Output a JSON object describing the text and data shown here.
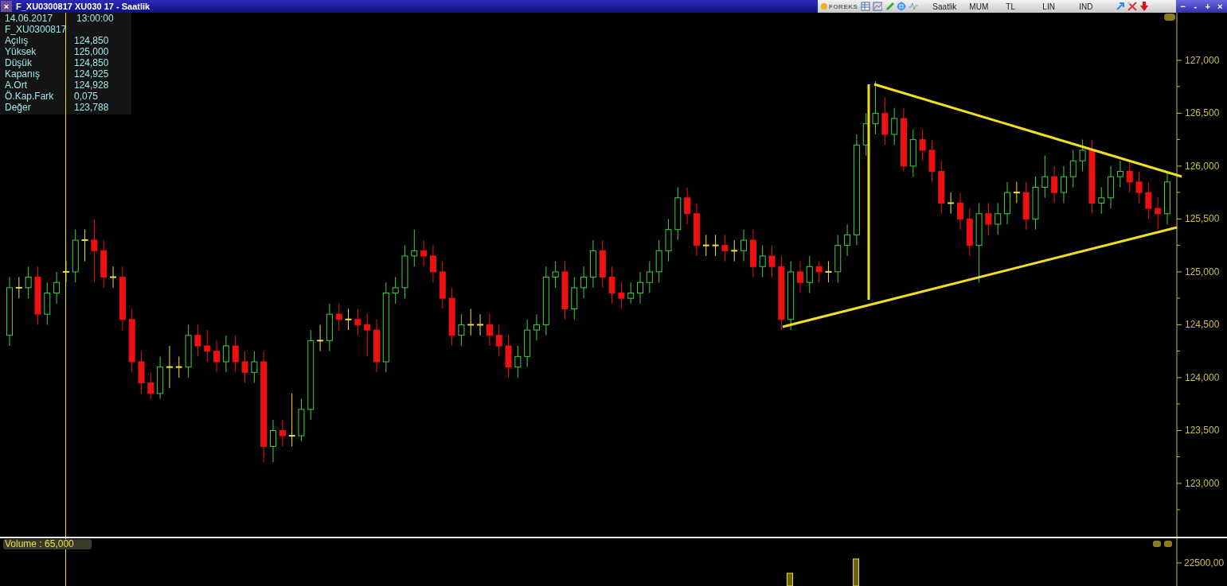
{
  "window": {
    "close": "×",
    "title": "F_XU0300817 XU030 17  - Saatlik"
  },
  "toolbar": {
    "logo": "FOREKS",
    "items": [
      "Saatlik",
      "MUM",
      "TL",
      "LIN",
      "IND"
    ],
    "window_buttons": [
      "−",
      "-",
      "+",
      "×"
    ]
  },
  "info_panel": {
    "date": "14.06.2017",
    "time": "13:00:00",
    "symbol": "F_XU0300817",
    "rows": [
      {
        "label": "Açılış",
        "value": "124,850"
      },
      {
        "label": "Yüksek",
        "value": "125,000"
      },
      {
        "label": "Düşük",
        "value": "124,850"
      },
      {
        "label": "Kapanış",
        "value": "124,925"
      },
      {
        "label": "A.Ort",
        "value": "124,928"
      },
      {
        "label": "Ö.Kap.Fark",
        "value": "0,075"
      },
      {
        "label": "Değer",
        "value": "123,788"
      }
    ]
  },
  "price_chart": {
    "chart_data": {
      "type": "candlestick",
      "ylim": [
        122,
        127.45
      ],
      "yticks": [
        {
          "value": 127,
          "label": "127,000"
        },
        {
          "value": 126.5,
          "label": "126,500"
        },
        {
          "value": 126,
          "label": "126,000"
        },
        {
          "value": 125.5,
          "label": "125,500"
        },
        {
          "value": 125,
          "label": "125,000"
        },
        {
          "value": 124.5,
          "label": "124,500"
        },
        {
          "value": 124,
          "label": "124,000"
        },
        {
          "value": 123.5,
          "label": "123,500"
        },
        {
          "value": 123,
          "label": "123,000"
        }
      ],
      "categories": [
        null,
        null,
        null,
        null,
        null,
        null,
        null,
        null,
        null,
        null,
        null,
        null,
        null,
        null,
        null,
        null,
        null,
        null,
        null,
        null,
        null,
        null,
        null,
        null,
        null,
        null,
        null,
        null,
        null,
        null,
        null,
        null,
        null,
        null,
        null,
        null,
        null,
        null,
        null,
        null,
        null,
        null,
        null,
        null,
        null,
        null,
        null,
        null,
        null,
        null,
        null,
        null,
        null,
        null,
        null,
        null,
        null,
        null,
        null,
        null,
        null,
        null,
        null,
        null,
        null,
        null,
        null,
        null,
        null,
        null,
        null,
        null,
        null,
        null,
        null,
        null,
        null,
        null,
        null,
        null,
        null,
        null,
        null,
        null,
        null,
        null,
        null,
        null,
        null,
        null,
        null,
        null,
        null,
        null,
        null,
        null,
        null,
        null,
        null,
        null,
        null,
        null,
        null,
        null,
        null,
        null,
        null,
        null,
        null,
        null,
        null,
        null,
        null,
        null,
        null,
        null,
        null,
        null,
        null,
        null,
        null,
        null,
        null,
        null
      ],
      "ohlc": [
        [
          124.4,
          124.95,
          124.3,
          124.85
        ],
        [
          124.85,
          124.95,
          124.75,
          124.85
        ],
        [
          124.85,
          125.05,
          124.75,
          124.95
        ],
        [
          124.95,
          125.05,
          124.5,
          124.6
        ],
        [
          124.6,
          124.9,
          124.5,
          124.8
        ],
        [
          124.8,
          125,
          124.7,
          124.9
        ],
        [
          125,
          125.1,
          124.9,
          125
        ],
        [
          125,
          125.4,
          124.9,
          125.3
        ],
        [
          125.3,
          125.4,
          125.1,
          125.3
        ],
        [
          125.3,
          125.5,
          124.9,
          125.2
        ],
        [
          125.2,
          125.3,
          124.85,
          124.95
        ],
        [
          124.95,
          125.05,
          124.85,
          124.95
        ],
        [
          124.95,
          125.05,
          124.45,
          124.55
        ],
        [
          124.55,
          124.65,
          124.05,
          124.15
        ],
        [
          124.15,
          124.25,
          123.85,
          123.95
        ],
        [
          123.95,
          124.05,
          123.8,
          123.85
        ],
        [
          123.85,
          124.2,
          123.8,
          124.1
        ],
        [
          124.1,
          124.3,
          123.9,
          124.1
        ],
        [
          124.1,
          124.2,
          124,
          124.1
        ],
        [
          124.1,
          124.5,
          124,
          124.4
        ],
        [
          124.4,
          124.5,
          124.2,
          124.3
        ],
        [
          124.3,
          124.45,
          124.15,
          124.25
        ],
        [
          124.25,
          124.35,
          124.05,
          124.15
        ],
        [
          124.15,
          124.4,
          124.05,
          124.3
        ],
        [
          124.3,
          124.4,
          124.05,
          124.15
        ],
        [
          124.15,
          124.25,
          123.95,
          124.05
        ],
        [
          124.05,
          124.25,
          123.95,
          124.15
        ],
        [
          124.15,
          124.25,
          123.2,
          123.35
        ],
        [
          123.35,
          123.6,
          123.2,
          123.5
        ],
        [
          123.5,
          123.6,
          123.35,
          123.45
        ],
        [
          123.45,
          123.85,
          123.35,
          123.45
        ],
        [
          123.45,
          123.8,
          123.4,
          123.7
        ],
        [
          123.7,
          124.45,
          123.6,
          124.35
        ],
        [
          124.35,
          124.5,
          124.25,
          124.35
        ],
        [
          124.35,
          124.7,
          124.25,
          124.6
        ],
        [
          124.6,
          124.7,
          124.45,
          124.55
        ],
        [
          124.55,
          124.65,
          124.45,
          124.55
        ],
        [
          124.55,
          124.65,
          124.4,
          124.5
        ],
        [
          124.5,
          124.6,
          124.2,
          124.45
        ],
        [
          124.45,
          124.55,
          124.05,
          124.15
        ],
        [
          124.15,
          124.9,
          124.05,
          124.8
        ],
        [
          124.8,
          124.95,
          124.7,
          124.85
        ],
        [
          124.85,
          125.25,
          124.75,
          125.15
        ],
        [
          125.15,
          125.4,
          125.05,
          125.2
        ],
        [
          125.2,
          125.3,
          125.05,
          125.15
        ],
        [
          125.15,
          125.25,
          124.9,
          125
        ],
        [
          125,
          125.1,
          124.65,
          124.75
        ],
        [
          124.75,
          124.85,
          124.3,
          124.4
        ],
        [
          124.4,
          124.6,
          124.3,
          124.5
        ],
        [
          124.5,
          124.65,
          124.4,
          124.5
        ],
        [
          124.5,
          124.6,
          124.4,
          124.5
        ],
        [
          124.5,
          124.6,
          124.3,
          124.4
        ],
        [
          124.4,
          124.5,
          124.2,
          124.3
        ],
        [
          124.3,
          124.4,
          124,
          124.1
        ],
        [
          124.1,
          124.3,
          124,
          124.2
        ],
        [
          124.2,
          124.55,
          124.1,
          124.45
        ],
        [
          124.45,
          124.6,
          124.35,
          124.5
        ],
        [
          124.5,
          125.05,
          124.4,
          124.95
        ],
        [
          124.95,
          125.1,
          124.85,
          125
        ],
        [
          125,
          125.1,
          124.55,
          124.65
        ],
        [
          124.65,
          124.95,
          124.55,
          124.85
        ],
        [
          124.85,
          125.05,
          124.75,
          124.95
        ],
        [
          124.95,
          125.3,
          124.85,
          125.2
        ],
        [
          125.2,
          125.3,
          124.85,
          124.95
        ],
        [
          124.95,
          125.05,
          124.7,
          124.8
        ],
        [
          124.8,
          124.9,
          124.65,
          124.75
        ],
        [
          124.75,
          124.9,
          124.7,
          124.8
        ],
        [
          124.8,
          125,
          124.7,
          124.9
        ],
        [
          124.9,
          125.1,
          124.8,
          125
        ],
        [
          125,
          125.3,
          124.9,
          125.2
        ],
        [
          125.2,
          125.5,
          125.1,
          125.4
        ],
        [
          125.4,
          125.8,
          125.3,
          125.7
        ],
        [
          125.7,
          125.8,
          125.45,
          125.55
        ],
        [
          125.55,
          125.65,
          125.15,
          125.25
        ],
        [
          125.25,
          125.35,
          125.15,
          125.25
        ],
        [
          125.25,
          125.35,
          125.15,
          125.25
        ],
        [
          125.25,
          125.35,
          125.1,
          125.2
        ],
        [
          125.2,
          125.3,
          125.1,
          125.2
        ],
        [
          125.2,
          125.4,
          125.1,
          125.3
        ],
        [
          125.3,
          125.4,
          124.95,
          125.05
        ],
        [
          125.05,
          125.25,
          124.95,
          125.15
        ],
        [
          125.15,
          125.25,
          124.95,
          125.05
        ],
        [
          125.05,
          125.15,
          124.45,
          124.55
        ],
        [
          124.55,
          125.1,
          124.45,
          125
        ],
        [
          125,
          125.1,
          124.8,
          124.9
        ],
        [
          124.9,
          125.15,
          124.8,
          125.05
        ],
        [
          125.05,
          125.1,
          124.9,
          125
        ],
        [
          125,
          125.1,
          124.9,
          125
        ],
        [
          125,
          125.35,
          124.9,
          125.25
        ],
        [
          125.25,
          125.45,
          125.15,
          125.35
        ],
        [
          125.35,
          126.3,
          125.25,
          126.2
        ],
        [
          126.2,
          126.5,
          126.1,
          126.4
        ],
        [
          126.4,
          126.8,
          126.3,
          126.5
        ],
        [
          126.5,
          126.65,
          126.2,
          126.3
        ],
        [
          126.3,
          126.55,
          126.2,
          126.45
        ],
        [
          126.45,
          126.55,
          125.95,
          126
        ],
        [
          126,
          126.35,
          125.9,
          126.25
        ],
        [
          126.25,
          126.35,
          126.05,
          126.15
        ],
        [
          126.15,
          126.25,
          125.85,
          125.95
        ],
        [
          125.95,
          126.05,
          125.55,
          125.65
        ],
        [
          125.65,
          125.75,
          125.55,
          125.65
        ],
        [
          125.65,
          125.75,
          125.4,
          125.5
        ],
        [
          125.5,
          125.6,
          125.15,
          125.25
        ],
        [
          125.25,
          125.65,
          124.9,
          125.55
        ],
        [
          125.55,
          125.65,
          125.35,
          125.45
        ],
        [
          125.45,
          125.65,
          125.35,
          125.55
        ],
        [
          125.55,
          125.85,
          125.45,
          125.75
        ],
        [
          125.75,
          125.85,
          125.65,
          125.75
        ],
        [
          125.75,
          125.85,
          125.4,
          125.5
        ],
        [
          125.5,
          125.9,
          125.4,
          125.8
        ],
        [
          125.8,
          126.1,
          125.7,
          125.9
        ],
        [
          125.9,
          126,
          125.65,
          125.75
        ],
        [
          125.75,
          126,
          125.65,
          125.9
        ],
        [
          125.9,
          126.15,
          125.8,
          126.05
        ],
        [
          126.05,
          126.25,
          125.95,
          126.15
        ],
        [
          126.15,
          126.25,
          125.55,
          125.65
        ],
        [
          125.65,
          125.8,
          125.55,
          125.7
        ],
        [
          125.7,
          126,
          125.6,
          125.9
        ],
        [
          125.9,
          126.05,
          125.8,
          125.95
        ],
        [
          125.95,
          126.05,
          125.75,
          125.85
        ],
        [
          125.85,
          125.95,
          125.65,
          125.75
        ],
        [
          125.75,
          125.85,
          125.5,
          125.6
        ],
        [
          125.6,
          125.7,
          125.4,
          125.55
        ],
        [
          125.55,
          125.95,
          125.45,
          125.85
        ]
      ]
    }
  },
  "volume_panel": {
    "label": "Volume : 65,000",
    "ticks": [
      "22500,00"
    ]
  }
}
